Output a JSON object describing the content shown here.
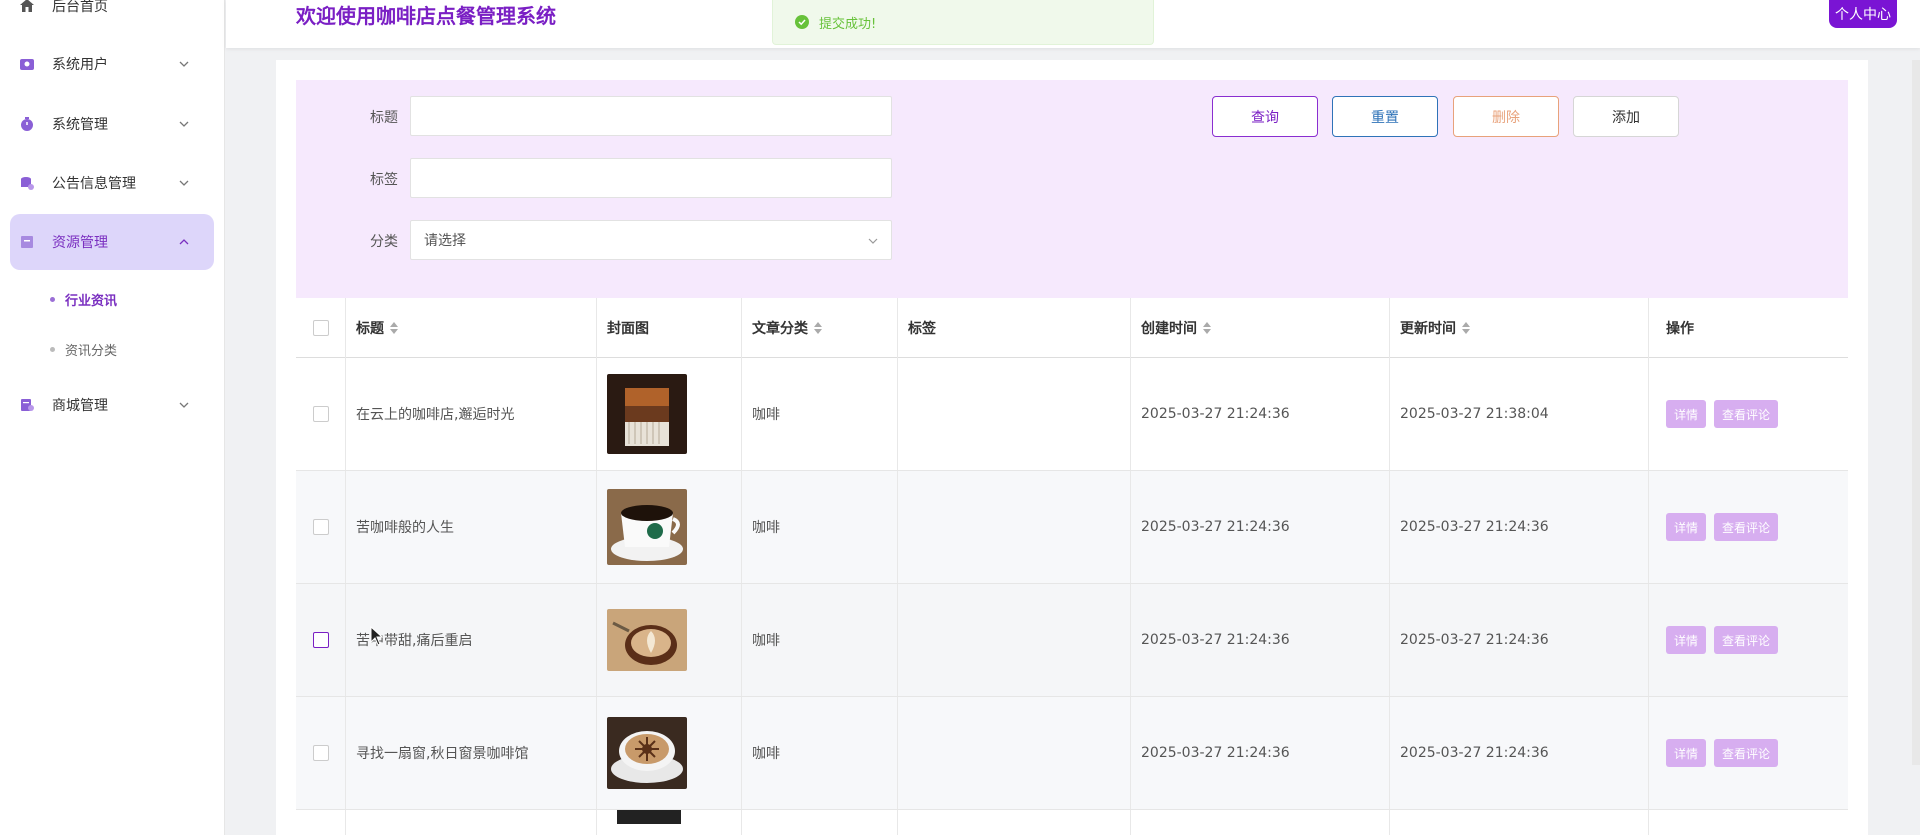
{
  "app": {
    "title": "欢迎使用咖啡店点餐管理系统",
    "user_center": "个人中心"
  },
  "toast": {
    "message": "提交成功!"
  },
  "sidebar": {
    "home": "后台首页",
    "items": [
      {
        "label": "系统用户"
      },
      {
        "label": "系统管理"
      },
      {
        "label": "公告信息管理"
      },
      {
        "label": "资源管理"
      },
      {
        "label": "商城管理"
      }
    ],
    "sub_items": [
      {
        "label": "行业资讯"
      },
      {
        "label": "资讯分类"
      }
    ]
  },
  "search": {
    "title_label": "标题",
    "tag_label": "标签",
    "category_label": "分类",
    "category_placeholder": "请选择",
    "buttons": {
      "query": "查询",
      "reset": "重置",
      "delete": "删除",
      "add": "添加"
    }
  },
  "table": {
    "headers": [
      "标题",
      "封面图",
      "文章分类",
      "标签",
      "创建时间",
      "更新时间",
      "操作"
    ],
    "rows": [
      {
        "title": "在云上的咖啡店,邂逅时光",
        "category": "咖啡",
        "tag": "",
        "created": "2025-03-27 21:24:36",
        "updated": "2025-03-27 21:38:04",
        "cover": "iced-coffee-glass"
      },
      {
        "title": "苦咖啡般的人生",
        "category": "咖啡",
        "tag": "",
        "created": "2025-03-27 21:24:36",
        "updated": "2025-03-27 21:24:36",
        "cover": "coffee-cup-saucer"
      },
      {
        "title": "苦中带甜,痛后重启",
        "category": "咖啡",
        "tag": "",
        "created": "2025-03-27 21:24:36",
        "updated": "2025-03-27 21:24:36",
        "cover": "latte-art"
      },
      {
        "title": "寻找一扇窗,秋日窗景咖啡馆",
        "category": "咖啡",
        "tag": "",
        "created": "2025-03-27 21:24:36",
        "updated": "2025-03-27 21:24:36",
        "cover": "cappuccino-flower"
      }
    ],
    "actions": {
      "detail": "详情",
      "comments": "查看评论"
    }
  },
  "colors": {
    "brand": "#7a14d4",
    "panel": "#f6e9fd",
    "action": "#d7aef0",
    "success": "#67c23a"
  }
}
